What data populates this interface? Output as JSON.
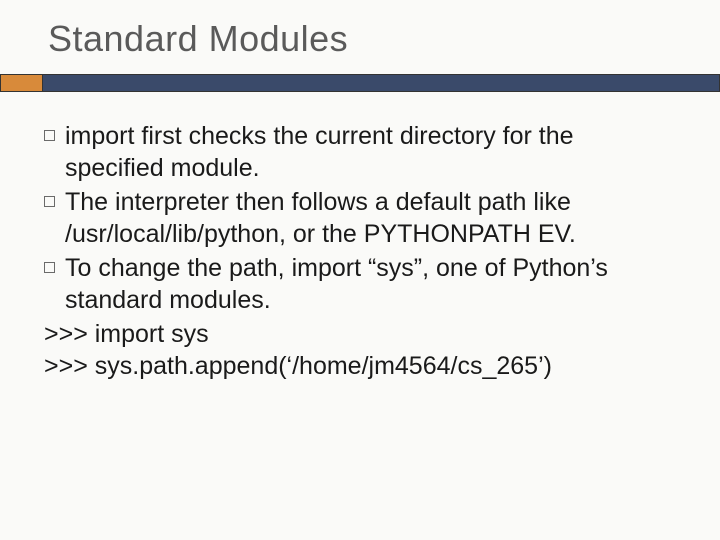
{
  "title": "Standard Modules",
  "bullets": [
    "import first checks the current directory for the specified module.",
    "The interpreter then follows a default path like /usr/local/lib/python, or the PYTHONPATH EV.",
    "To change the path, import “sys”, one of Python’s standard modules."
  ],
  "code": [
    ">>> import sys",
    ">>> sys.path.append(‘/home/jm4564/cs_265’)"
  ]
}
